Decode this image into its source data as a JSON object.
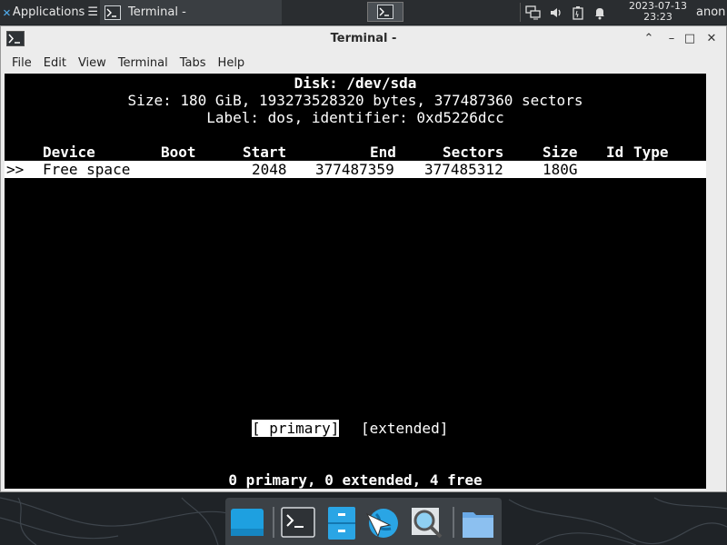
{
  "panel": {
    "applications_label": "Applications",
    "applications_suffix": "☰",
    "task_title": "Terminal -",
    "clock_date": "2023-07-13",
    "clock_time": "23:23",
    "user": "anon"
  },
  "window": {
    "title": "Terminal -",
    "menu": [
      "File",
      "Edit",
      "View",
      "Terminal",
      "Tabs",
      "Help"
    ],
    "btn_minimize": "⌃",
    "btn_min": "–",
    "btn_max": "□",
    "btn_close": "✕"
  },
  "terminal": {
    "disk_line": "Disk: /dev/sda",
    "size_line": "Size: 180 GiB, 193273528320 bytes, 377487360 sectors",
    "label_line": "Label: dos, identifier: 0xd5226dcc",
    "header": {
      "device": "Device",
      "boot": "Boot",
      "start": "Start",
      "end": "End",
      "sectors": "Sectors",
      "size": "Size",
      "id": "Id",
      "type": "Type"
    },
    "row": {
      "cursor": ">>",
      "device": "Free space",
      "start": "2048",
      "end": "377487359",
      "sectors": "377485312",
      "size": "180G"
    },
    "btn_primary": "[ primary]",
    "btn_extended": "[extended]",
    "status": "0 primary, 0 extended, 4 free"
  },
  "colors": {
    "panel": "#2a2d30",
    "terminal_bg": "#000000",
    "selection_bg": "#ffffff",
    "dock": "#3c4146"
  }
}
